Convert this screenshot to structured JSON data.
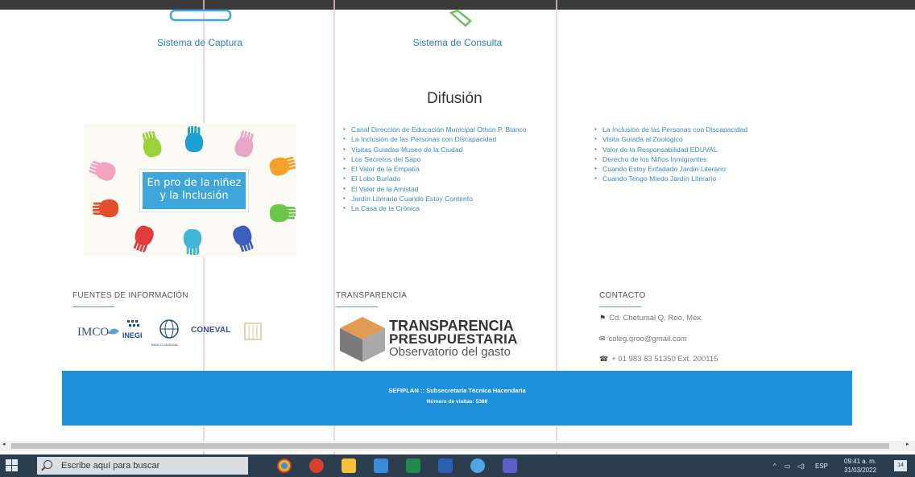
{
  "systems": {
    "capture_label": "Sistema de Captura",
    "consult_label": "Sistema de Consulta"
  },
  "difusion": {
    "title": "Difusión",
    "banner_text_line1": "En pro de la niñez",
    "banner_text_line2": "y la Inclusión",
    "links_col1": [
      "Canal Dirección de Educación Municipal Othon P. Blanco",
      "La Inclusión de las Personas con Discapacidad",
      "Visitas Guiadas Museo de la Ciudad",
      "Los Secretos del Sapo",
      "El Valor de la Empatía",
      "El Lobo Burlado",
      "El Valor de la Amistad",
      "Jardín Literario Cuando Estoy Contento",
      "La Casa de la Crónica"
    ],
    "links_col2": [
      "La Inclusión de las Personas con Discapacidad",
      "Visita Guiada al Zoológico",
      "Valor de la Responsabilidad EDUVAL",
      "Derecho de los Niños Inmigrantes",
      "Cuando Estoy Enfadado Jardín Literario",
      "Cuando Tengo Miedo Jardín Literario"
    ]
  },
  "sections": {
    "fuentes_heading": "FUENTES DE INFORMACIÓN",
    "transparencia_heading": "TRANSPARENCIA",
    "contacto_heading": "CONTACTO",
    "logos": {
      "imco": "IMCO",
      "inegi": "INEGI",
      "banco_mundial": "BANCO MUNDIAL",
      "coneval": "CONEVAL"
    },
    "transparencia_logo": {
      "line1": "TRANSPARENCIA",
      "line2": "PRESUPUESTARIA",
      "line3": "Observatorio del gasto"
    },
    "contact": {
      "location": "Cd. Chetumal Q. Roo, Méx.",
      "email": "coleg.qroo@gmail.com",
      "phone": "+ 01 983 83 51350 Ext. 200115"
    }
  },
  "footer": {
    "line1": "SEFIPLAN :: Subsecretaría Técnica Hacendaria",
    "line2": "Número de visitas: 5388"
  },
  "taskbar": {
    "search_placeholder": "Escribe aquí para buscar",
    "language": "ESP",
    "time": "09:41 a. m.",
    "date": "31/03/2022",
    "notification_count": "14",
    "apps": [
      "chrome-icon",
      "pdf-icon",
      "file-explorer-icon",
      "mail-icon",
      "excel-icon",
      "word-icon",
      "browser-icon",
      "teams-icon"
    ]
  },
  "colors": {
    "link": "#3b89c9",
    "footer_bg": "#1e90dc",
    "taskbar_bg": "#2c3d4d"
  }
}
